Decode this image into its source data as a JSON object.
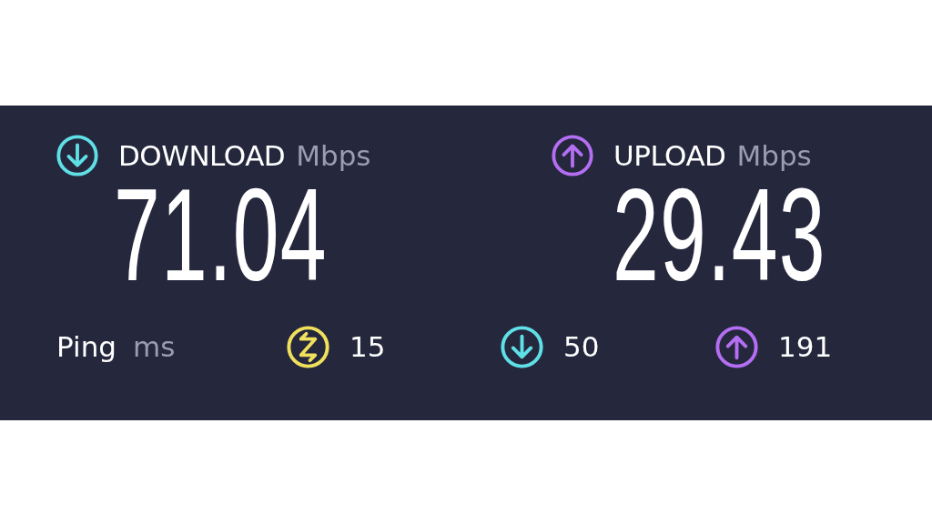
{
  "download": {
    "label": "DOWNLOAD",
    "unit": "Mbps",
    "value": "71.04"
  },
  "upload": {
    "label": "UPLOAD",
    "unit": "Mbps",
    "value": "29.43"
  },
  "ping": {
    "label": "Ping",
    "unit": "ms",
    "values": [
      {
        "kind": "idle",
        "value": "15"
      },
      {
        "kind": "download",
        "value": "50"
      },
      {
        "kind": "upload",
        "value": "191"
      }
    ]
  }
}
